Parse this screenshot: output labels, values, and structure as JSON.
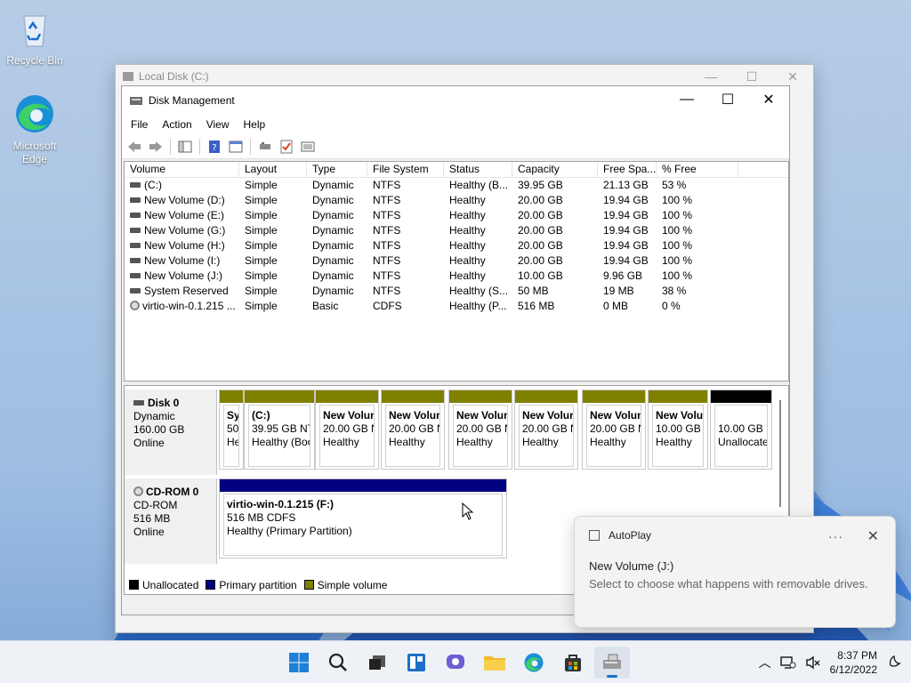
{
  "desktop": {
    "recycle_bin": "Recycle Bin",
    "edge": "Microsoft Edge"
  },
  "bg_window": {
    "title": "Local Disk (C:)"
  },
  "window": {
    "title": "Disk Management",
    "menu": [
      "File",
      "Action",
      "View",
      "Help"
    ]
  },
  "volumes": {
    "columns": [
      "Volume",
      "Layout",
      "Type",
      "File System",
      "Status",
      "Capacity",
      "Free Spa...",
      "% Free"
    ],
    "rows": [
      {
        "icon": "drive",
        "cells": [
          "(C:)",
          "Simple",
          "Dynamic",
          "NTFS",
          "Healthy (B...",
          "39.95 GB",
          "21.13 GB",
          "53 %"
        ]
      },
      {
        "icon": "drive",
        "cells": [
          "New Volume (D:)",
          "Simple",
          "Dynamic",
          "NTFS",
          "Healthy",
          "20.00 GB",
          "19.94 GB",
          "100 %"
        ]
      },
      {
        "icon": "drive",
        "cells": [
          "New Volume (E:)",
          "Simple",
          "Dynamic",
          "NTFS",
          "Healthy",
          "20.00 GB",
          "19.94 GB",
          "100 %"
        ]
      },
      {
        "icon": "drive",
        "cells": [
          "New Volume (G:)",
          "Simple",
          "Dynamic",
          "NTFS",
          "Healthy",
          "20.00 GB",
          "19.94 GB",
          "100 %"
        ]
      },
      {
        "icon": "drive",
        "cells": [
          "New Volume (H:)",
          "Simple",
          "Dynamic",
          "NTFS",
          "Healthy",
          "20.00 GB",
          "19.94 GB",
          "100 %"
        ]
      },
      {
        "icon": "drive",
        "cells": [
          "New Volume (I:)",
          "Simple",
          "Dynamic",
          "NTFS",
          "Healthy",
          "20.00 GB",
          "19.94 GB",
          "100 %"
        ]
      },
      {
        "icon": "drive",
        "cells": [
          "New Volume (J:)",
          "Simple",
          "Dynamic",
          "NTFS",
          "Healthy",
          "10.00 GB",
          "9.96 GB",
          "100 %"
        ]
      },
      {
        "icon": "drive",
        "cells": [
          "System Reserved",
          "Simple",
          "Dynamic",
          "NTFS",
          "Healthy (S...",
          "50 MB",
          "19 MB",
          "38 %"
        ]
      },
      {
        "icon": "cd",
        "cells": [
          "virtio-win-0.1.215 ...",
          "Simple",
          "Basic",
          "CDFS",
          "Healthy (P...",
          "516 MB",
          "0 MB",
          "0 %"
        ]
      }
    ]
  },
  "disks": [
    {
      "name": "Disk 0",
      "lines": [
        "Dynamic",
        "160.00 GB",
        "Online"
      ],
      "partitions": [
        {
          "color": "#808000",
          "lines": [
            "Sy",
            "50",
            "He"
          ]
        },
        {
          "color": "#808000",
          "lines": [
            "(C:)",
            "39.95 GB NT",
            "Healthy (Boo"
          ]
        },
        {
          "color": "#808000",
          "lines": [
            "New Volun",
            "20.00 GB N",
            "Healthy"
          ]
        },
        {
          "color": "#808000",
          "lines": [
            "New Volun",
            "20.00 GB N",
            "Healthy"
          ]
        },
        {
          "color": "#808000",
          "lines": [
            "New Volun",
            "20.00 GB N",
            "Healthy"
          ]
        },
        {
          "color": "#808000",
          "lines": [
            "New Volun",
            "20.00 GB N",
            "Healthy"
          ]
        },
        {
          "color": "#808000",
          "lines": [
            "New Volun",
            "20.00 GB N",
            "Healthy"
          ]
        },
        {
          "color": "#808000",
          "lines": [
            "New Volu",
            "10.00 GB N",
            "Healthy"
          ]
        },
        {
          "color": "#000000",
          "lines": [
            "",
            "10.00 GB",
            "Unallocate"
          ]
        }
      ]
    },
    {
      "name": "CD-ROM 0",
      "lines": [
        "CD-ROM",
        "516 MB",
        "Online"
      ],
      "partitions": [
        {
          "color": "#000080",
          "lines": [
            "virtio-win-0.1.215  (F:)",
            "516 MB CDFS",
            "Healthy (Primary Partition)"
          ]
        }
      ]
    }
  ],
  "legend": [
    {
      "label": "Unallocated",
      "color": "#000000"
    },
    {
      "label": "Primary partition",
      "color": "#000080"
    },
    {
      "label": "Simple volume",
      "color": "#808000"
    }
  ],
  "toast": {
    "app": "AutoPlay",
    "title": "New Volume (J:)",
    "body": "Select to choose what happens with removable drives."
  },
  "taskbar": {
    "time": "8:37 PM",
    "date": "6/12/2022"
  }
}
